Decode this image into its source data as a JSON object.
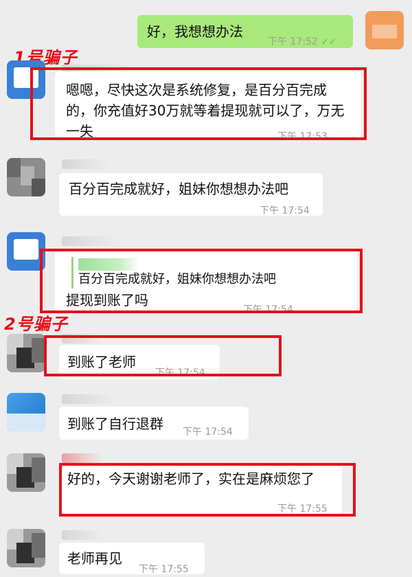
{
  "annotations": {
    "scammer_1": "1号骗子",
    "scammer_2": "2号骗子"
  },
  "messages": [
    {
      "sender": "self",
      "text": "好，我想想办法",
      "time": "下午 17:52",
      "read_icon": "double-check-icon"
    },
    {
      "sender": "scammer-1",
      "text": "嗯嗯，尽快这次是系统修复，是百分百完成的，你充值好30万就等着提现就可以了，万无一失",
      "time": "下午 17:53"
    },
    {
      "sender": "other-b",
      "text": "百分百完成就好，姐妹你想想办法吧",
      "time": "下午 17:54"
    },
    {
      "sender": "scammer-1",
      "quote": "百分百完成就好，姐妹你想想办法吧",
      "text": "提现到账了吗",
      "time": "下午 17:54"
    },
    {
      "sender": "scammer-2",
      "text": "到账了老师",
      "time": "下午 17:54"
    },
    {
      "sender": "other-c",
      "text": "到账了自行退群",
      "time": "下午 17:54"
    },
    {
      "sender": "scammer-2",
      "text": "好的，今天谢谢老师了，实在是麻烦您了",
      "time": "下午 17:55"
    },
    {
      "sender": "scammer-2",
      "text": "老师再见",
      "time": "下午 17:55"
    }
  ],
  "colors": {
    "background": "#ededed",
    "bubble_self": "#a9e97c",
    "bubble_other": "#ffffff",
    "highlight": "#e60e1b"
  }
}
